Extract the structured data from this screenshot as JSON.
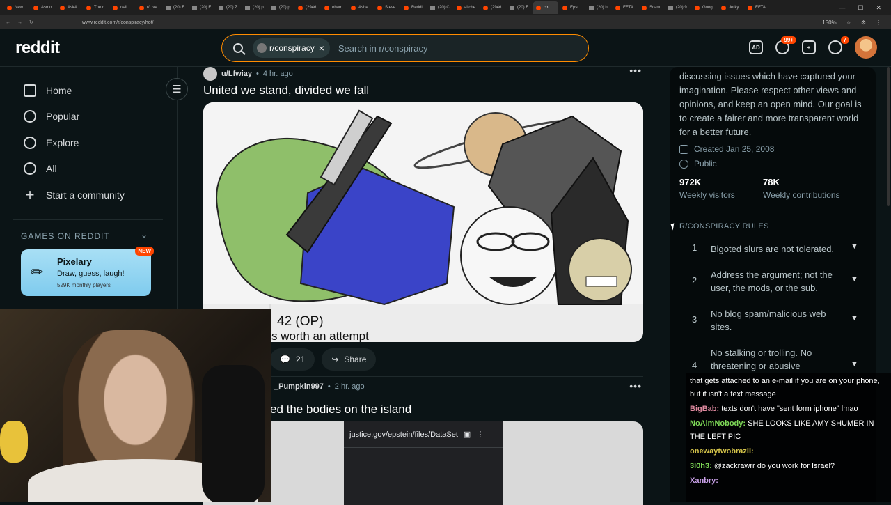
{
  "browser": {
    "tabs": [
      "New",
      "Asmo",
      "AskA",
      "The r",
      "r/all",
      "r/Live",
      "(20) F",
      "(20) E",
      "(20) Z",
      "(20) p",
      "(20) p",
      "(2946",
      "obam",
      "Ashe",
      "Steve",
      "Reddi",
      "(20) C",
      "ai che",
      "(2946",
      "(20) F",
      "co",
      "Epst",
      "(20) h",
      "EFTA",
      "Scam",
      "(20) 9",
      "Goog",
      "Jerky",
      "EFTA"
    ],
    "active_tab_index": 20,
    "url": "www.reddit.com/r/conspiracy/hot/",
    "zoom": "150%"
  },
  "header": {
    "logo": "reddit",
    "search_chip": "r/conspiracy",
    "search_placeholder": "Search in r/conspiracy",
    "chat_badge": "99+",
    "notif_badge": "7"
  },
  "nav": {
    "items": [
      "Home",
      "Popular",
      "Explore",
      "All",
      "Start a community"
    ],
    "games_heading": "GAMES ON REDDIT",
    "game": {
      "title": "Pixelary",
      "desc": "Draw, guess, laugh!",
      "players": "529K monthly players",
      "badge": "NEW"
    }
  },
  "post1": {
    "user": "u/Lfwiay",
    "time": "4 hr. ago",
    "title": "United we stand, divided we fall",
    "image_caption_1": "42 (OP)",
    "image_caption_2": "s worth an attempt",
    "comments": "21",
    "share_label": "Share"
  },
  "post2": {
    "user": "_Pumpkin997",
    "time": "2 hr. ago",
    "title": "ed the bodies on the island",
    "embed_url": "justice.gov/epstein/files/DataSet"
  },
  "sidebar": {
    "about": "discussing issues which have captured your imagination. Please respect other views and opinions, and keep an open mind. Our goal is to create a fairer and more transparent world for a better future.",
    "created": "Created Jan 25, 2008",
    "visibility": "Public",
    "stats": [
      {
        "value": "972K",
        "label": "Weekly visitors"
      },
      {
        "value": "78K",
        "label": "Weekly contributions"
      }
    ],
    "rules_heading": "R/CONSPIRACY RULES",
    "rules": [
      {
        "num": "1",
        "text": "Bigoted slurs are not tolerated."
      },
      {
        "num": "2",
        "text": "Address the argument; not the user, the mods, or the sub."
      },
      {
        "num": "3",
        "text": "No blog spam/malicious web sites."
      },
      {
        "num": "4",
        "text": "No stalking or trolling. No threatening or abusive"
      }
    ]
  },
  "chat": [
    {
      "user": "",
      "color": "#ffffff",
      "text": "that gets attached to an e-mail if you are on your phone, but it isn't a text message"
    },
    {
      "user": "BigBab:",
      "color": "#e08aa0",
      "text": "texts don't have \"sent form iphone\" lmao"
    },
    {
      "user": "NoAimNobody:",
      "color": "#7ed957",
      "text": "SHE LOOKS LIKE AMY SHUMER IN THE LEFT PIC"
    },
    {
      "user": "onewaytwobrazil:",
      "color": "#d4c34a",
      "text": ""
    },
    {
      "user": "3l0h3:",
      "color": "#7ed957",
      "text": "@zackrawrr do you work for Israel?"
    },
    {
      "user": "Xanbry:",
      "color": "#c9a0e8",
      "text": ""
    }
  ],
  "colors": {
    "accent": "#ff4500",
    "search_border": "#ff8c00",
    "bg": "#0b1416"
  }
}
